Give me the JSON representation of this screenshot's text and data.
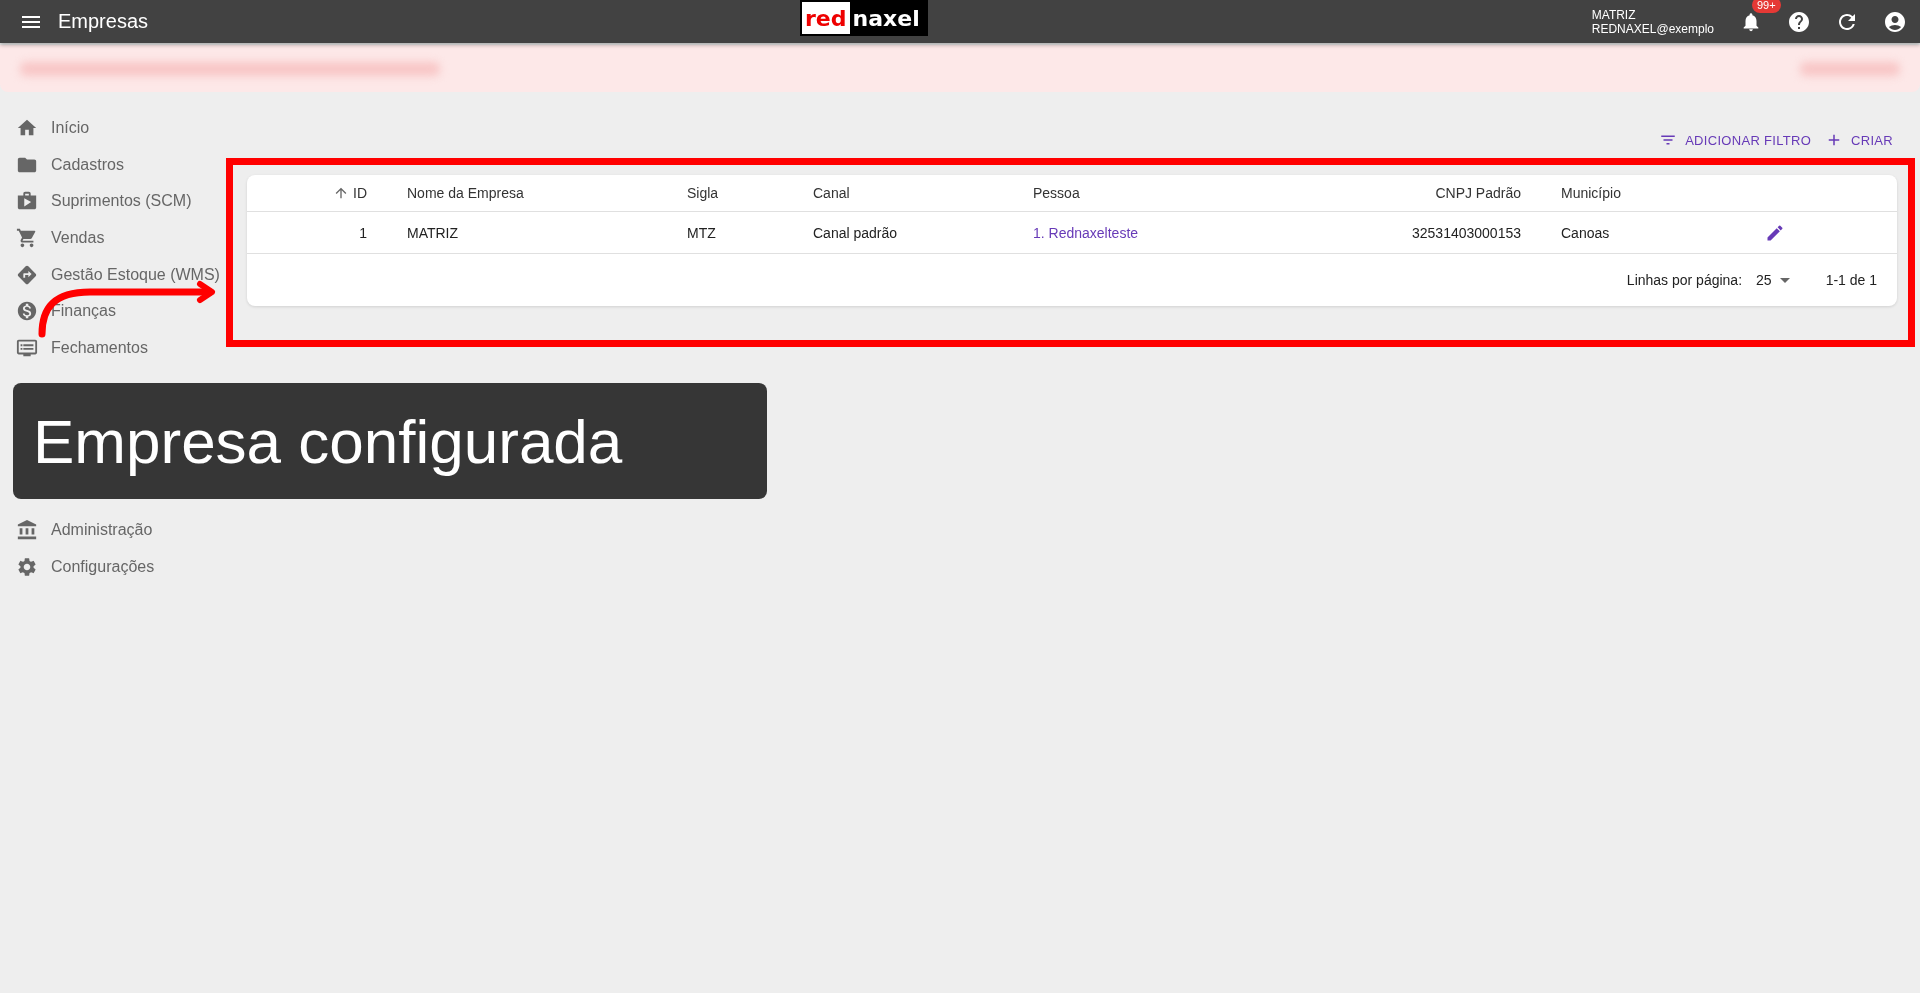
{
  "top_bar": {
    "title": "Empresas",
    "logo": {
      "part_1": "red",
      "part_2": "naxel"
    },
    "user": {
      "company": "MATRIZ",
      "login": "REDNAXEL@exemplo"
    },
    "notifications": {
      "count": "99+"
    }
  },
  "sidebar": {
    "items": [
      {
        "label": "Início"
      },
      {
        "label": "Cadastros"
      },
      {
        "label": "Suprimentos (SCM)"
      },
      {
        "label": "Vendas"
      },
      {
        "label": "Gestão Estoque (WMS)"
      },
      {
        "label": "Finanças"
      },
      {
        "label": "Fechamentos"
      }
    ],
    "items_below": [
      {
        "label": "Administração"
      },
      {
        "label": "Configurações"
      }
    ]
  },
  "actions": [
    "ADICIONAR FILTRO",
    "CRIAR"
  ],
  "table": {
    "columns": [
      {
        "label": "ID",
        "sorted": true
      },
      {
        "label": "Nome da Empresa",
        "sorted": false
      },
      {
        "label": "Sigla",
        "sorted": false
      },
      {
        "label": "Canal",
        "sorted": false
      },
      {
        "label": "Pessoa",
        "sorted": false
      },
      {
        "label": "CNPJ Padrão",
        "sorted": false
      },
      {
        "label": "Município",
        "sorted": false
      }
    ],
    "rows": [
      {
        "cells": [
          {
            "text": "1"
          },
          {
            "text": "MATRIZ"
          },
          {
            "text": "MTZ"
          },
          {
            "text": "Canal padrão"
          },
          {
            "text": "1. Rednaxelteste",
            "kind": "link"
          },
          {
            "text": "32531403000153"
          },
          {
            "text": "Canoas"
          }
        ]
      }
    ],
    "pagination": {
      "label": "Linhas por página:",
      "per_page": "25",
      "range": "1-1 de 1"
    }
  },
  "caption": "Empresa configurada"
}
